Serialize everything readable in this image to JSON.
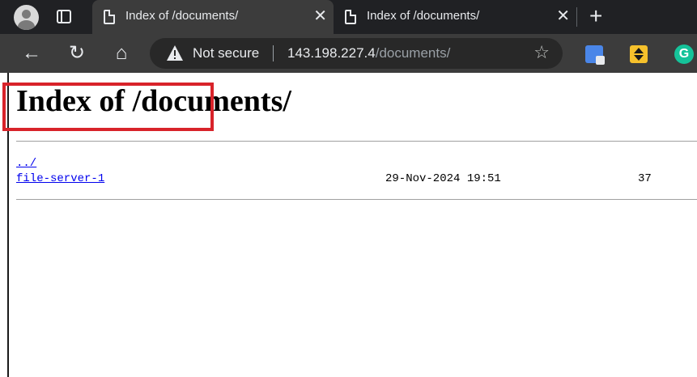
{
  "browser": {
    "tabs": [
      {
        "title": "Index of /documents/",
        "active": true,
        "close": "✕"
      },
      {
        "title": "Index of /documents/",
        "active": false,
        "close": "✕"
      }
    ],
    "new_tab": "+",
    "nav": {
      "back": "←",
      "reload": "↻",
      "home": "⌂"
    },
    "omnibox": {
      "security_label": "Not secure",
      "url_host": "143.198.227.4",
      "url_path": "/documents/",
      "bookmark_icon": "☆"
    },
    "extensions": [
      "translate-icon",
      "arrows-extension-icon",
      "grammarly-icon"
    ],
    "grammarly_letter": "G"
  },
  "page": {
    "title": "Index of /documents/",
    "entries": [
      {
        "name": "../",
        "date": "",
        "size": ""
      },
      {
        "name": "file-server-1",
        "date": "29-Nov-2024 19:51",
        "size": "37"
      }
    ]
  },
  "colors": {
    "annotation_box": "#d8232a",
    "link": "#0000ee",
    "chrome_dark": "#202124",
    "toolbar": "#3c3c3c"
  }
}
